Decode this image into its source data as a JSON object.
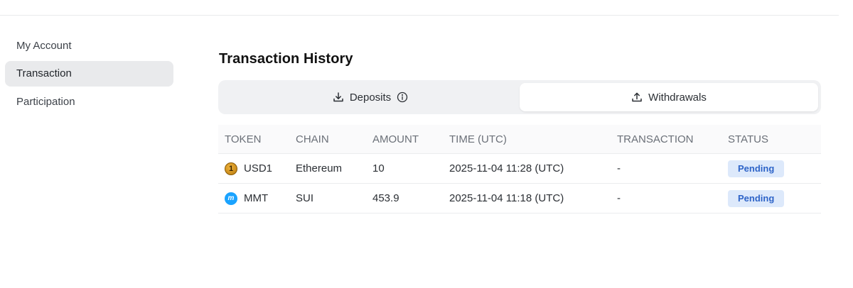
{
  "sidebar": {
    "items": [
      {
        "label": "My Account",
        "active": false
      },
      {
        "label": "Transaction",
        "active": true
      },
      {
        "label": "Participation",
        "active": false
      }
    ]
  },
  "main": {
    "title": "Transaction History",
    "tabs": [
      {
        "label": "Deposits",
        "icon": "download-icon",
        "extra_icon": "info-icon",
        "active": false
      },
      {
        "label": "Withdrawals",
        "icon": "upload-icon",
        "active": true
      }
    ],
    "table": {
      "headers": {
        "token": "TOKEN",
        "chain": "CHAIN",
        "amount": "AMOUNT",
        "time": "TIME (UTC)",
        "transaction": "TRANSACTION",
        "status": "STATUS"
      },
      "rows": [
        {
          "token": "USD1",
          "token_icon": "usd1-token-icon",
          "chain": "Ethereum",
          "amount": "10",
          "time": "2025-11-04 11:28 (UTC)",
          "transaction": "-",
          "status": "Pending"
        },
        {
          "token": "MMT",
          "token_icon": "mmt-token-icon",
          "chain": "SUI",
          "amount": "453.9",
          "time": "2025-11-04 11:18 (UTC)",
          "transaction": "-",
          "status": "Pending"
        }
      ]
    }
  },
  "colors": {
    "active_bg": "#e9eaec",
    "badge_bg": "#dde9fb",
    "badge_text": "#2e64c8",
    "mmt_blue": "#1aa3ff",
    "usd1_gold": "#d99a22"
  }
}
